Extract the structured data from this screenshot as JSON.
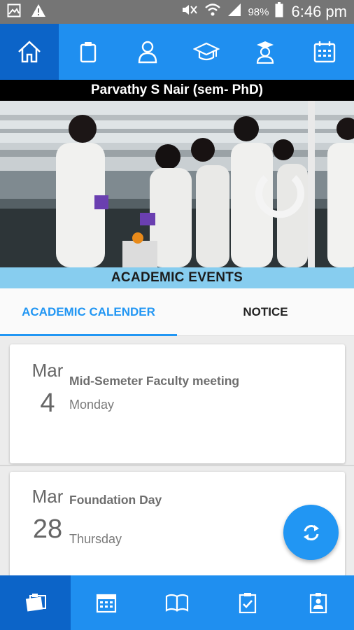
{
  "status_bar": {
    "left_icons": [
      "image-icon",
      "warning-icon"
    ],
    "right_icons": [
      "mute-icon",
      "wifi-icon",
      "signal-icon",
      "battery-icon"
    ],
    "battery": "98%",
    "time": "6:46 pm"
  },
  "top_nav": {
    "items": [
      {
        "icon": "home-icon",
        "active": true
      },
      {
        "icon": "clipboard-icon",
        "active": false
      },
      {
        "icon": "person-icon",
        "active": false
      },
      {
        "icon": "graduation-cap-icon",
        "active": false
      },
      {
        "icon": "student-icon",
        "active": false
      },
      {
        "icon": "calendar-icon",
        "active": false
      }
    ]
  },
  "user": {
    "name": "Parvathy S Nair (sem- PhD)"
  },
  "hero": {
    "image": "laboratory-students-photo"
  },
  "events": {
    "heading": "ACADEMIC EVENTS"
  },
  "tabs": [
    {
      "label": "ACADEMIC CALENDER",
      "active": true
    },
    {
      "label": "NOTICE",
      "active": false
    }
  ],
  "event_list": [
    {
      "month": "Mar",
      "day": "4",
      "title": "Mid-Semeter Faculty meeting",
      "weekday": "Monday"
    },
    {
      "month": "Mar",
      "day": "28",
      "title": "Foundation Day",
      "weekday": "Thursday"
    }
  ],
  "fab": {
    "icon": "refresh-icon"
  },
  "bottom_nav": {
    "items": [
      {
        "icon": "notes-icon",
        "active": true
      },
      {
        "icon": "calendar-grid-icon",
        "active": false
      },
      {
        "icon": "book-icon",
        "active": false
      },
      {
        "icon": "checklist-icon",
        "active": false
      },
      {
        "icon": "id-badge-icon",
        "active": false
      }
    ]
  },
  "colors": {
    "primary": "#1f8ff0",
    "primary_dark": "#0c64c8",
    "accent": "#2196f3",
    "events_bar": "#87cdef",
    "status_bar": "#757575"
  }
}
